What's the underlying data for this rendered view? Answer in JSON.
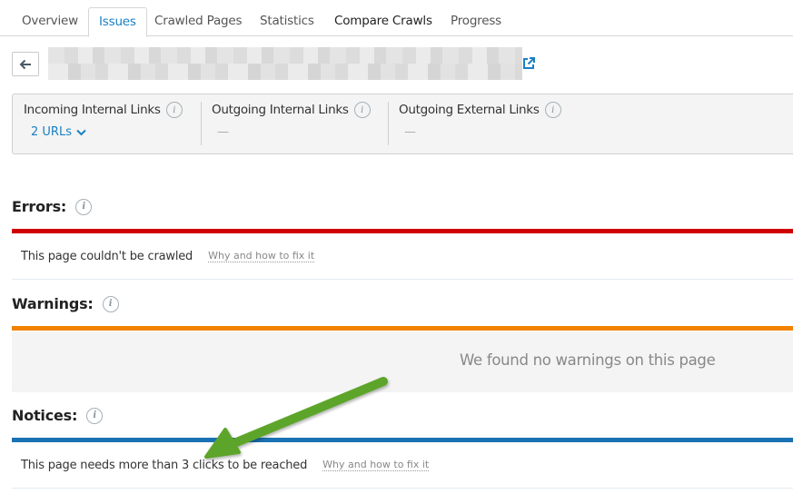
{
  "tabs": [
    {
      "label": "Overview",
      "active": false
    },
    {
      "label": "Issues",
      "active": true
    },
    {
      "label": "Crawled Pages",
      "active": false
    },
    {
      "label": "Statistics",
      "active": false
    },
    {
      "label": "Compare Crawls",
      "active": false
    },
    {
      "label": "Progress",
      "active": false
    }
  ],
  "page_url": {
    "blurred": true
  },
  "icons": {
    "back": "arrow-left-icon",
    "external": "external-link-icon",
    "info": "info-icon",
    "chevron": "chevron-down-icon"
  },
  "links_summary": {
    "incoming_internal": {
      "label": "Incoming Internal Links",
      "value": "2 URLs"
    },
    "outgoing_internal": {
      "label": "Outgoing Internal Links",
      "value": "—"
    },
    "outgoing_external": {
      "label": "Outgoing External Links",
      "value": "—"
    }
  },
  "sections": {
    "errors": {
      "title": "Errors:",
      "color": "#d00000",
      "items": [
        {
          "text": "This page couldn't be crawled",
          "link": "Why and how to fix it"
        }
      ]
    },
    "warnings": {
      "title": "Warnings:",
      "color": "#f28100",
      "empty_message": "We found no warnings on this page"
    },
    "notices": {
      "title": "Notices:",
      "color": "#1a72b4",
      "items": [
        {
          "text": "This page needs more than 3 clicks to be reached",
          "link": "Why and how to fix it"
        }
      ]
    }
  },
  "colors": {
    "accent": "#1a80c4",
    "annotation_arrow": "#5da52a"
  }
}
